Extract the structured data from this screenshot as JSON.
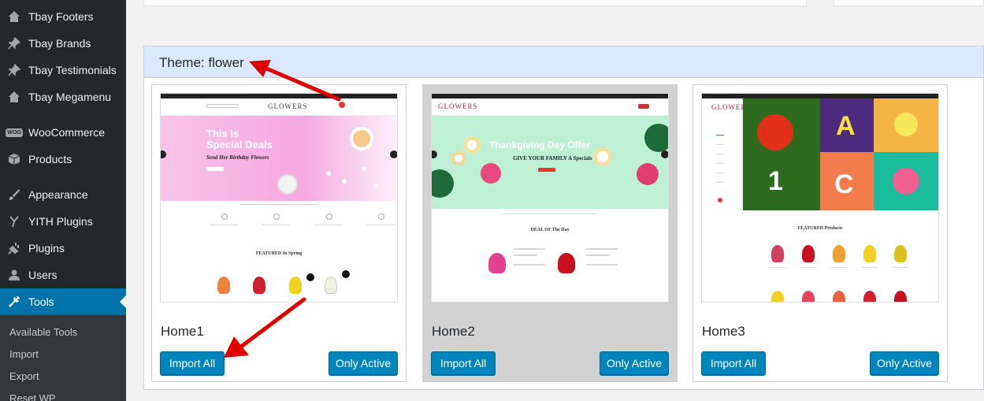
{
  "sidebar": {
    "items": [
      {
        "label": "Tbay Footers",
        "icon": "home-icon"
      },
      {
        "label": "Tbay Brands",
        "icon": "pin-icon"
      },
      {
        "label": "Tbay Testimonials",
        "icon": "pin-icon"
      },
      {
        "label": "Tbay Megamenu",
        "icon": "home-icon"
      },
      {
        "label": "WooCommerce",
        "icon": "woo-icon"
      },
      {
        "label": "Products",
        "icon": "box-icon"
      },
      {
        "label": "Appearance",
        "icon": "brush-icon"
      },
      {
        "label": "YITH Plugins",
        "icon": "yith-icon"
      },
      {
        "label": "Plugins",
        "icon": "plug-icon"
      },
      {
        "label": "Users",
        "icon": "user-icon"
      },
      {
        "label": "Tools",
        "icon": "wrench-icon"
      }
    ],
    "woo_badge": "WOO",
    "submenu": [
      "Available Tools",
      "Import",
      "Export",
      "Reset WP"
    ]
  },
  "theme": {
    "title": "Theme: flower"
  },
  "demos": [
    {
      "name": "Home1",
      "import_label": "Import All",
      "active_label": "Only Active"
    },
    {
      "name": "Home2",
      "import_label": "Import All",
      "active_label": "Only Active"
    },
    {
      "name": "Home3",
      "import_label": "Import All",
      "active_label": "Only Active"
    }
  ],
  "previews": {
    "logo": "GLOWERS",
    "home1": {
      "hero_title_1": "This Is",
      "hero_title_2": "Special Deals",
      "hero_sub": "Send Her Birthday Flowers",
      "section": "FEATURED In Spring"
    },
    "home2": {
      "hero_title": "Thankgiving Day Offer",
      "hero_sub": "GIVE YOUR FAMILY A Specials",
      "section": "DEAL OF The Day"
    },
    "home3": {
      "section": "FEATURED Products",
      "tile_a": "A",
      "tile_c": "C",
      "tile_1": "1"
    }
  },
  "colors": {
    "sidebar_bg": "#23282d",
    "active_bg": "#0073aa",
    "button_bg": "#0085ba",
    "header_bg": "#dbe8fd",
    "annotation": "#e00000"
  }
}
